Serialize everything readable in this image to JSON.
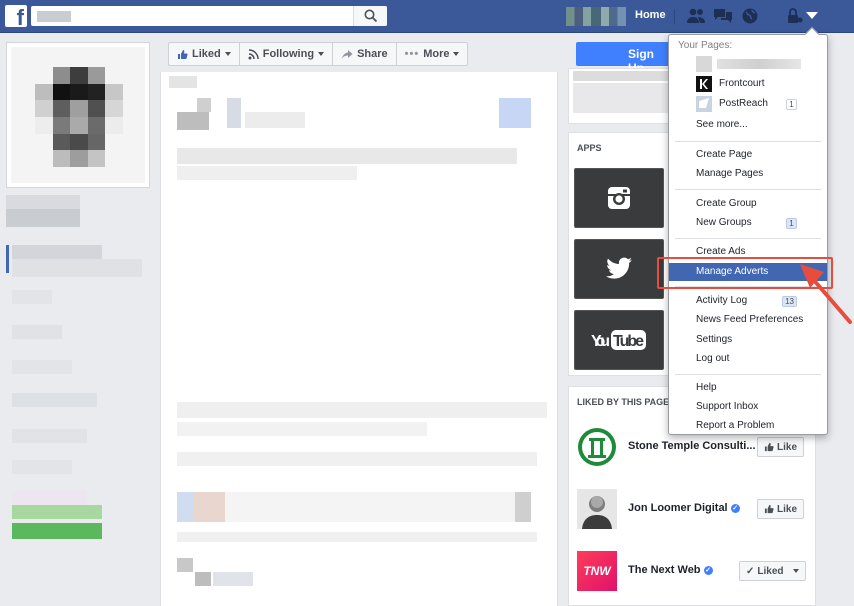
{
  "topbar": {
    "logo": "f",
    "home_label": "Home"
  },
  "action_bar": {
    "liked_label": "Liked",
    "following_label": "Following",
    "share_label": "Share",
    "more_label": "More"
  },
  "signup_label": "Sign Up",
  "right_column": {
    "apps_header": "APPS",
    "liked_header": "LIKED BY THIS PAGE",
    "apps": [
      {
        "icon": "instagram-icon"
      },
      {
        "icon": "twitter-icon"
      },
      {
        "icon": "youtube-icon",
        "label": "YouTube"
      }
    ],
    "liked_pages": [
      {
        "name": "Stone Temple Consulti...",
        "verified": false,
        "button": "Like"
      },
      {
        "name": "Jon Loomer Digital",
        "verified": true,
        "button": "Like"
      },
      {
        "name": "The Next Web",
        "verified": true,
        "button": "Liked"
      }
    ],
    "tnw_logo": "TNW"
  },
  "dropdown": {
    "header": "Your Pages:",
    "pages": [
      {
        "name": "Frontcourt",
        "badge": ""
      },
      {
        "name": "PostReach",
        "badge": "1"
      }
    ],
    "see_more": "See more...",
    "items": [
      {
        "label": "Create Page"
      },
      {
        "label": "Manage Pages"
      },
      {
        "label": "Create Group"
      },
      {
        "label": "New Groups",
        "badge": "1"
      },
      {
        "label": "Create Ads"
      },
      {
        "label": "Manage Adverts",
        "highlighted": true
      },
      {
        "label": "Activity Log",
        "badge": "13"
      },
      {
        "label": "News Feed Preferences"
      },
      {
        "label": "Settings"
      },
      {
        "label": "Log out"
      },
      {
        "label": "Help"
      },
      {
        "label": "Support Inbox"
      },
      {
        "label": "Report a Problem"
      }
    ]
  },
  "colors": {
    "facebook_blue": "#3b5998",
    "highlight": "#4267b2",
    "annotation_red": "#e74c3c",
    "signup_blue": "#4080ff"
  }
}
